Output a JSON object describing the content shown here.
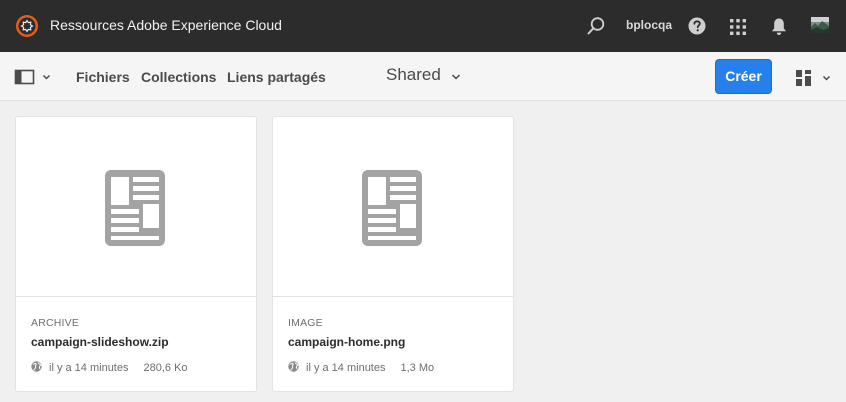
{
  "header": {
    "app_title": "Ressources Adobe Experience Cloud",
    "user_name": "bplocqa"
  },
  "actionbar": {
    "nav": {
      "files": "Fichiers",
      "collections": "Collections",
      "links": "Liens partagés"
    },
    "context_title": "Shared",
    "create_label": "Créer"
  },
  "cards": [
    {
      "type": "ARCHIVE",
      "name": "campaign-slideshow.zip",
      "modified": "il y a 14 minutes",
      "size": "280,6 Ko"
    },
    {
      "type": "IMAGE",
      "name": "campaign-home.png",
      "modified": "il y a 14 minutes",
      "size": "1,3 Mo"
    }
  ],
  "colors": {
    "header_bg": "#2c2c2c",
    "accent": "#2680eb",
    "logo_orange": "#e65c1a",
    "placeholder_icon": "#a3a3a3"
  }
}
